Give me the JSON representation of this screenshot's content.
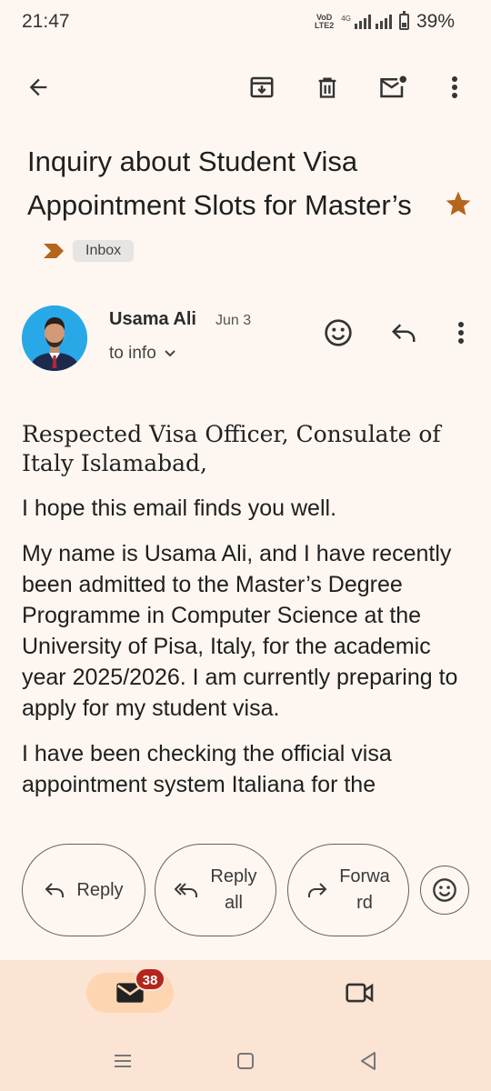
{
  "status_bar": {
    "time": "21:47",
    "network_label": "VoD LTE2",
    "network_type": "4G",
    "battery_percent": "39%",
    "battery_level": 0.39
  },
  "toolbar": {
    "back_icon": "arrow-back-icon",
    "archive_icon": "archive-icon",
    "delete_icon": "trash-icon",
    "mark_unread_icon": "mark-unread-icon",
    "more_icon": "more-vert-icon"
  },
  "subject": {
    "text": "Inquiry about Student Visa Appointment Slots for Master’s",
    "label_chip": "Inbox",
    "starred": true,
    "star_color": "#b5651d",
    "importance_color": "#b5651d"
  },
  "sender": {
    "name": "Usama Ali",
    "date": "Jun 3",
    "recipient": "to info"
  },
  "email": {
    "greeting": "Respected Visa Officer, Consulate of Italy Islamabad,",
    "paragraphs": [
      "I hope this email finds you well.",
      "My name is Usama Ali, and I have recently been admitted to the Master’s Degree Programme in Computer Science at the University of Pisa, Italy, for the academic year 2025/2026. I am currently preparing to apply for my student visa.",
      "I have been checking the official visa appointment system Italiana for the"
    ]
  },
  "actions": {
    "reply": "Reply",
    "reply_all_line1": "Reply",
    "reply_all_line2": "all",
    "forward_line1": "Forwa",
    "forward_line2": "rd",
    "react_icon": "emoji-icon"
  },
  "bottom_nav": {
    "mail_badge": "38",
    "mail_icon": "mail-icon",
    "meet_icon": "video-icon"
  },
  "colors": {
    "background": "#fdf6f1",
    "nav_background": "#fbe4d4",
    "badge": "#b3261e",
    "accent": "#b5651d"
  }
}
